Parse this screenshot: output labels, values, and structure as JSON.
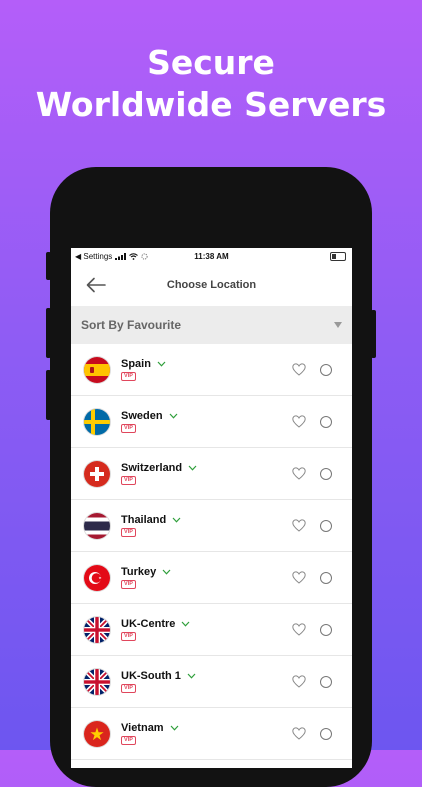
{
  "headline": {
    "line1": "Secure",
    "line2": "Worldwide Servers"
  },
  "status_bar": {
    "carrier": "◀ Settings",
    "time": "11:38 AM"
  },
  "nav": {
    "title": "Choose Location"
  },
  "sort": {
    "label": "Sort By Favourite"
  },
  "vip_label": "VIP",
  "locations": [
    {
      "name": "Spain",
      "flag": "spain-flag-icon"
    },
    {
      "name": "Sweden",
      "flag": "sweden-flag-icon"
    },
    {
      "name": "Switzerland",
      "flag": "switzerland-flag-icon"
    },
    {
      "name": "Thailand",
      "flag": "thailand-flag-icon"
    },
    {
      "name": "Turkey",
      "flag": "turkey-flag-icon"
    },
    {
      "name": "UK-Centre",
      "flag": "uk-flag-icon"
    },
    {
      "name": "UK-South 1",
      "flag": "uk-flag-icon"
    },
    {
      "name": "Vietnam",
      "flag": "vietnam-flag-icon"
    }
  ],
  "colors": {
    "accent_green": "#2e9e3a",
    "vip_red": "#e0465c",
    "background_top": "#b45ef9",
    "background_bottom": "#6d56f0"
  }
}
